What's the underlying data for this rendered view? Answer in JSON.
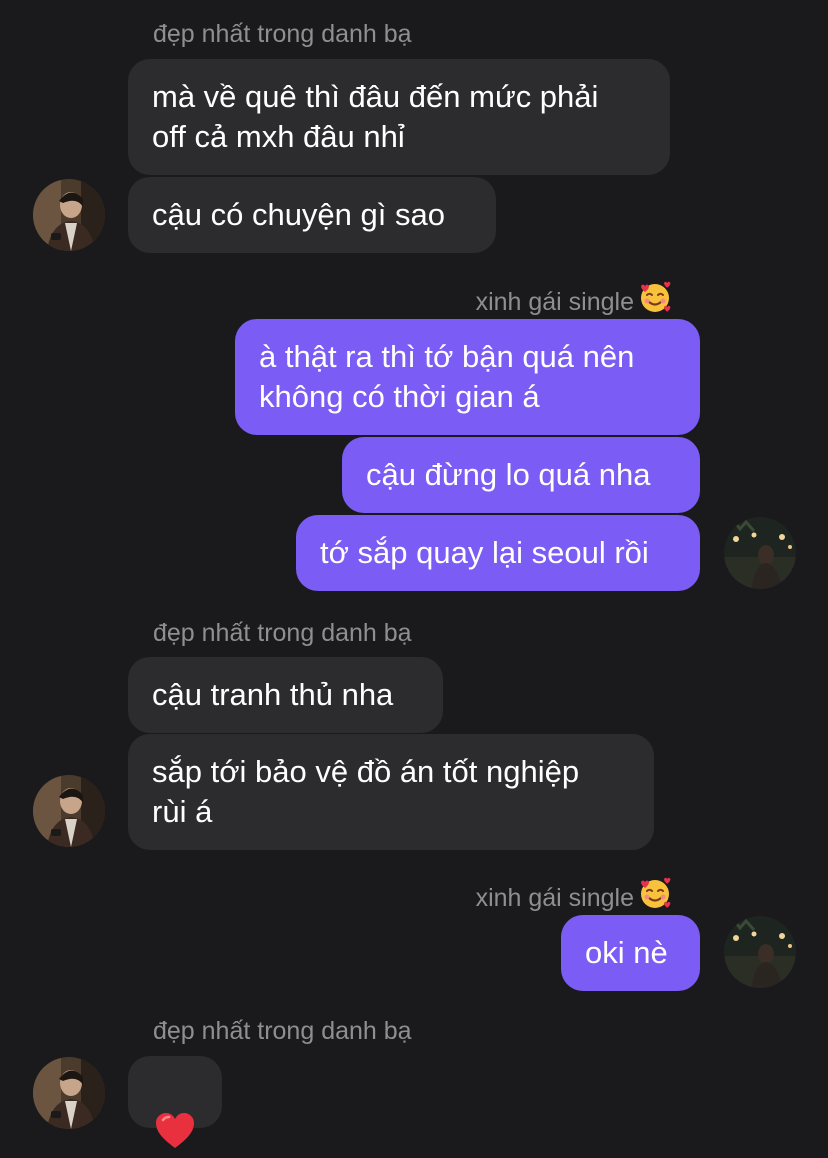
{
  "contact_name": "đẹp nhất trong danh bạ",
  "my_name": "xinh gái single",
  "my_name_emoji": "smiling-face-with-hearts",
  "colors": {
    "background": "#1a1a1c",
    "incoming_bubble": "#2c2c2e",
    "outgoing_bubble": "#7b5cf5",
    "sender_label": "#8e8e93"
  },
  "messages": [
    {
      "from": "contact",
      "text": "mà về quê thì đâu đến mức phải\noff cả mxh đâu nhỉ"
    },
    {
      "from": "contact",
      "text": "cậu có chuyện gì sao"
    },
    {
      "from": "me",
      "text": "à thật ra thì tớ bận quá nên\nkhông có thời gian á"
    },
    {
      "from": "me",
      "text": "cậu đừng lo quá nha"
    },
    {
      "from": "me",
      "text": "tớ sắp quay lại seoul rồi"
    },
    {
      "from": "contact",
      "text": "cậu tranh thủ nha"
    },
    {
      "from": "contact",
      "text": "sắp tới bảo vệ đồ án tốt nghiệp\nrùi á"
    },
    {
      "from": "me",
      "text": "oki nè"
    },
    {
      "from": "contact",
      "text": "❤️",
      "kind": "heart-reaction"
    }
  ]
}
